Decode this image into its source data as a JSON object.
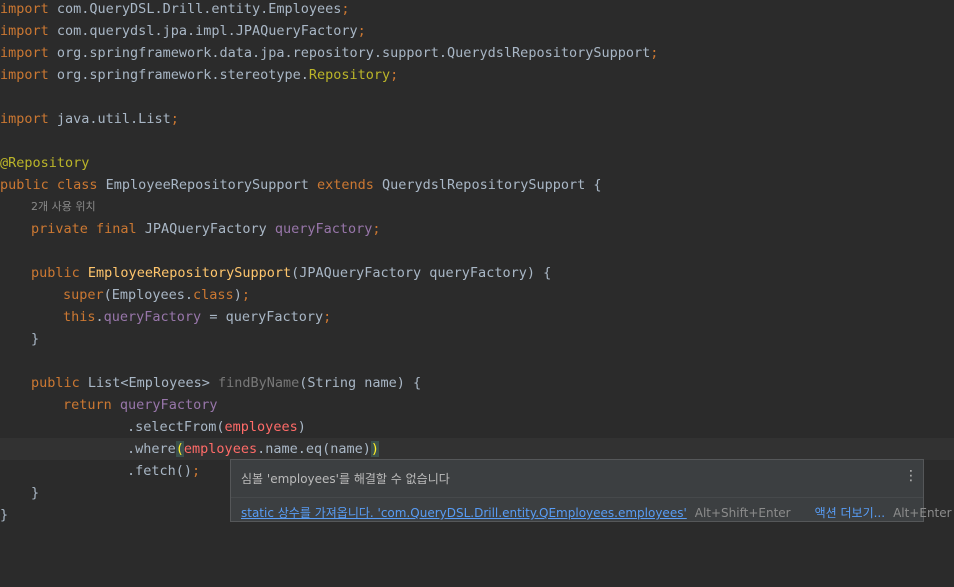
{
  "code": {
    "l1": {
      "kw": "import",
      "rest": " com.QueryDSL.Drill.entity.Employees",
      "semi": ";"
    },
    "l2": {
      "kw": "import",
      "rest": " com.querydsl.jpa.impl.JPAQueryFactory",
      "semi": ";"
    },
    "l3": {
      "kw": "import",
      "rest": " org.springframework.data.jpa.repository.support.QuerydslRepositorySupport",
      "semi": ";"
    },
    "l4": {
      "kw": "import",
      "rest": " org.springframework.stereotype.",
      "ann": "Repository",
      "semi": ";"
    },
    "l6": {
      "kw": "import",
      "rest": " java.util.List",
      "semi": ";"
    },
    "l8": {
      "ann": "@Repository"
    },
    "l9": {
      "kw1": "public class",
      "name": " EmployeeRepositorySupport ",
      "kw2": "extends",
      "rest": " QuerydslRepositorySupport {"
    },
    "hint1": "2개 사용 위치",
    "l10": {
      "kw": "private final",
      "type": " JPAQueryFactory ",
      "fld": "queryFactory",
      "semi": ";"
    },
    "l12": {
      "kw": "public",
      "fn": "EmployeeRepositorySupport",
      "rest": "(JPAQueryFactory queryFactory) {"
    },
    "l13": {
      "kw": "super",
      "mid": "(Employees.",
      "kw2": "class",
      "end": ")",
      "semi": ";"
    },
    "l14": {
      "kw": "this",
      "dot": ".",
      "fld": "queryFactory",
      "rest": " = queryFactory",
      "semi": ";"
    },
    "l15": {
      "text": "}"
    },
    "l17": {
      "kw": "public",
      "type": " List<Employees> ",
      "fn": "findByName",
      "rest": "(String name) {"
    },
    "l18": {
      "kw": "return",
      "fld": "queryFactory"
    },
    "l19": {
      "pre": ".selectFrom(",
      "err": "employees",
      "post": ")"
    },
    "l20": {
      "pre": ".where",
      "open": "(",
      "err": "employees",
      "mid": ".name.eq(name)",
      "close": ")"
    },
    "l21": {
      "text": ".fetch()",
      "semi": ";"
    },
    "l22": {
      "text": "}"
    },
    "l23": {
      "text": "}"
    }
  },
  "popup": {
    "message": "심볼 'employees'를 해결할 수 없습니다",
    "menu_icon": "⋮",
    "fix_label": "static 상수를 가져옵니다. 'com.QueryDSL.Drill.entity.QEmployees.employees'",
    "fix_shortcut": "Alt+Shift+Enter",
    "more_label": "액션 더보기...",
    "more_shortcut": "Alt+Enter"
  }
}
